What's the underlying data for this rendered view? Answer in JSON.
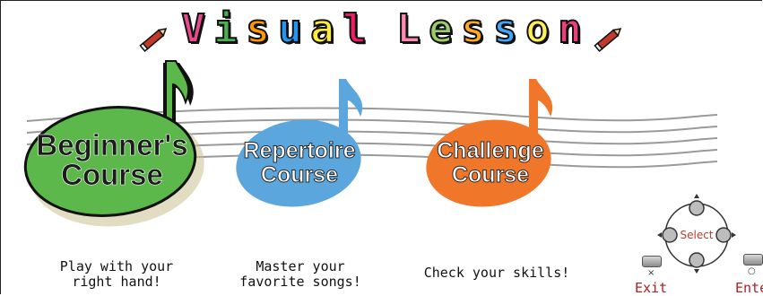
{
  "title": {
    "letters": [
      "V",
      "i",
      "s",
      "u",
      "a",
      "l",
      " ",
      "L",
      "e",
      "s",
      "s",
      "o",
      "n"
    ],
    "colors": [
      "#e84a8c",
      "#4caf50",
      "#ff9800",
      "#2196f3",
      "#ffeb3b",
      "#e91e63",
      "",
      "#ff8ab0",
      "#9ccc65",
      "#ffa726",
      "#42a5f5",
      "#ffee58",
      "#ec407a"
    ]
  },
  "courses": {
    "beginner": {
      "line1": "Beginner's",
      "line2": "Course",
      "color": "#5cb84a",
      "description_line1": "Play with your",
      "description_line2": "right hand!"
    },
    "repertoire": {
      "line1": "Repertoire",
      "line2": "Course",
      "color": "#5ba6dc",
      "description_line1": "Master your",
      "description_line2": "favorite songs!"
    },
    "challenge": {
      "line1": "Challenge",
      "line2": "Course",
      "color": "#f0772a",
      "description_line1": "Check your skills!"
    }
  },
  "controls": {
    "select_label": "Select",
    "exit_symbol": "×",
    "exit_label": "Exit",
    "enter_symbol": "○",
    "enter_label": "Enter"
  },
  "icons": {
    "title_left": "pencil-icon",
    "title_right": "pencil-icon",
    "dpad": "dpad-icon"
  }
}
